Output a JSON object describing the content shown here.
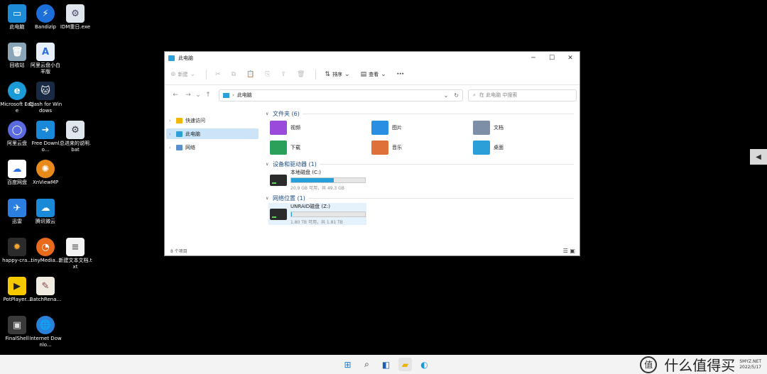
{
  "desktop": {
    "icons": [
      {
        "label": "此电脑"
      },
      {
        "label": "Bandizip"
      },
      {
        "label": "IDM重日.exe"
      },
      {
        "label": "回收站"
      },
      {
        "label": "阿里云盘小白羊版"
      },
      {
        "label": "Microsoft Edge"
      },
      {
        "label": "Clash for Windows"
      },
      {
        "label": "阿里云盘"
      },
      {
        "label": "Free Downlo..."
      },
      {
        "label": "总进来的说明.bat"
      },
      {
        "label": "百度网盘"
      },
      {
        "label": "XnViewMP"
      },
      {
        "label": "迅雷"
      },
      {
        "label": "腾讯微云"
      },
      {
        "label": "happy-cra..."
      },
      {
        "label": "tinyMedia..."
      },
      {
        "label": "新建文本文档.txt"
      },
      {
        "label": "PotPlayer..."
      },
      {
        "label": "BatchRena..."
      },
      {
        "label": "FinalShell"
      },
      {
        "label": "Internet Downlo..."
      }
    ]
  },
  "window": {
    "title": "此电脑",
    "controls": {
      "minimize": "─",
      "maximize": "☐",
      "close": "✕"
    },
    "toolbar": {
      "new_label": "新建",
      "sort_label": "排序",
      "view_label": "查看",
      "more_label": "···"
    },
    "address": {
      "back": "←",
      "forward": "→",
      "recent": "⌄",
      "up": "↑",
      "crumb": "此电脑",
      "search_placeholder": "在 此电脑 中搜索"
    },
    "sidebar": {
      "items": [
        {
          "label": "快速访问"
        },
        {
          "label": "此电脑"
        },
        {
          "label": "网络"
        }
      ]
    },
    "groups": {
      "folders_header": "文件夹 (6)",
      "folders": [
        {
          "label": "视频",
          "color": "#9a4ad8"
        },
        {
          "label": "图片",
          "color": "#2a8fe0"
        },
        {
          "label": "文档",
          "color": "#7d8fa6"
        },
        {
          "label": "下载",
          "color": "#2aa05a"
        },
        {
          "label": "音乐",
          "color": "#e0703a"
        },
        {
          "label": "桌面",
          "color": "#2a9fd8"
        }
      ],
      "devices_header": "设备和驱动器 (1)",
      "local_disk": {
        "name": "本地磁盘 (C:)",
        "detail": "20.9 GB 可用，共 49.3 GB",
        "used_fraction": 0.58
      },
      "network_header": "网络位置 (1)",
      "network_disk": {
        "name": "UNRAID磁盘 (Z:)",
        "detail": "1.80 TB 可用，共 1.81 TB",
        "used_fraction": 0.01
      }
    },
    "status": {
      "count": "8 个项目"
    }
  },
  "taskbar": {
    "watermark": "什么值得买",
    "site": "SMYZ.NET",
    "date": "2022/5/17"
  }
}
